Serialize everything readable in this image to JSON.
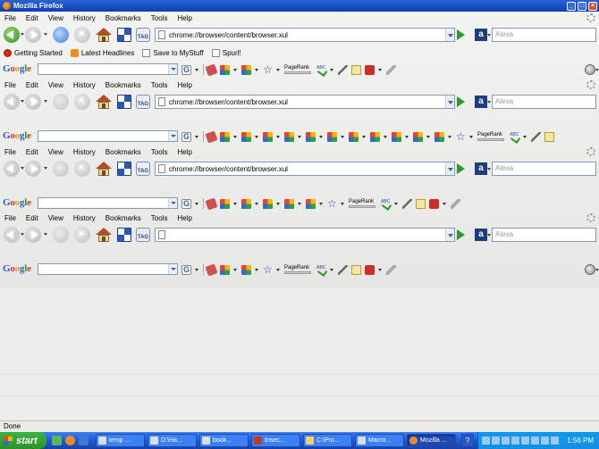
{
  "window": {
    "title": "Mozilla Firefox"
  },
  "menubar": {
    "items": [
      {
        "label": "File",
        "key": "F"
      },
      {
        "label": "Edit",
        "key": "E"
      },
      {
        "label": "View",
        "key": "V"
      },
      {
        "label": "History",
        "key": "s"
      },
      {
        "label": "Bookmarks",
        "key": "B"
      },
      {
        "label": "Tools",
        "key": "T"
      },
      {
        "label": "Help",
        "key": "H"
      }
    ]
  },
  "navbars": [
    {
      "url": "chrome://browser/content/browser.xul",
      "search_placeholder": "Alexa",
      "back_enabled": true
    },
    {
      "url": "chrome://browser/content/browser.xul",
      "search_placeholder": "Alexa",
      "back_enabled": false
    },
    {
      "url": "chrome://browser/content/browser.xul",
      "search_placeholder": "Alexa",
      "back_enabled": false
    },
    {
      "url": "",
      "search_placeholder": "Alexa",
      "back_enabled": false
    }
  ],
  "bookmarks": [
    {
      "label": "Getting Started",
      "icon": "bug-icon"
    },
    {
      "label": "Latest Headlines",
      "icon": "rss-icon"
    },
    {
      "label": "Save to MyStuff",
      "icon": "page-icon"
    },
    {
      "label": "Spurl!",
      "icon": "page-icon"
    }
  ],
  "googlebar": {
    "logo_text": "Google",
    "pagerank_label": "PageRank",
    "spellcheck_label": "ABC"
  },
  "status": {
    "text": "Done"
  },
  "taskbar": {
    "start_label": "start",
    "tasks": [
      {
        "label": "temp ...",
        "active": false
      },
      {
        "label": "D:\\Ha...",
        "active": false
      },
      {
        "label": "book...",
        "active": false
      },
      {
        "label": "Insec...",
        "active": false
      },
      {
        "label": "C:\\Pro...",
        "active": false
      },
      {
        "label": "Macro...",
        "active": false
      },
      {
        "label": "Mozilla ...",
        "active": true
      }
    ],
    "help_label": "?",
    "clock": "1:56 PM"
  },
  "colors": {
    "title_bar": "#0a3fb4",
    "taskbar": "#245edb",
    "start_button": "#2a922a",
    "chrome_bg": "#e6e6e3"
  }
}
